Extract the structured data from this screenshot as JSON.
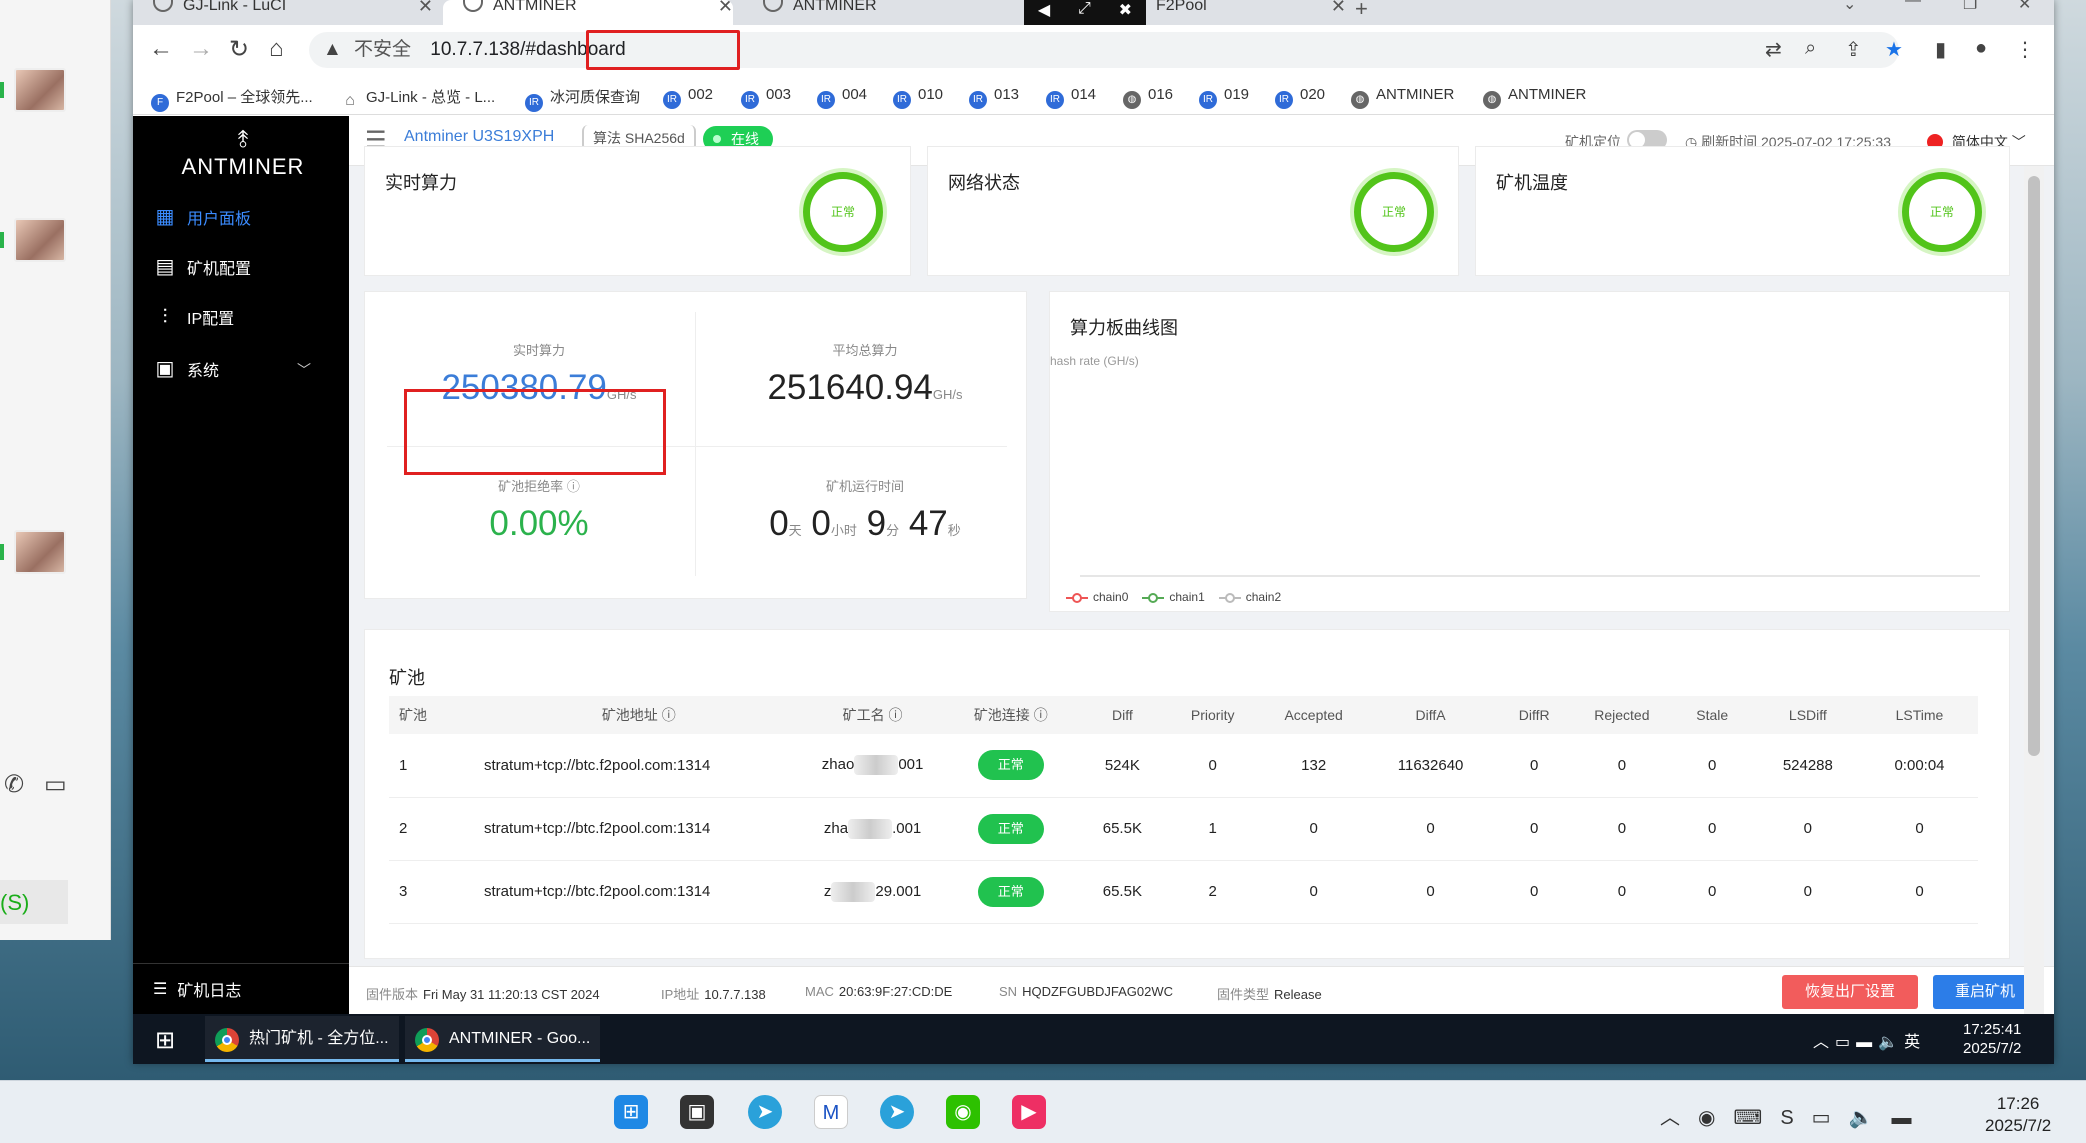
{
  "wechat": {
    "s_label": "(S)"
  },
  "tabs": [
    {
      "title": "GJ-Link - LuCI"
    },
    {
      "title": "ANTMINER"
    },
    {
      "title": "ANTMINER"
    },
    {
      "title": "F2Pool"
    }
  ],
  "address": {
    "insecure": "不安全",
    "url": "10.7.7.138/#dashboard"
  },
  "bookmarks": [
    {
      "label": "F2Pool – 全球领先..."
    },
    {
      "label": "GJ-Link - 总览 - L..."
    },
    {
      "label": "冰河质保查询"
    },
    {
      "label": "002"
    },
    {
      "label": "003"
    },
    {
      "label": "004"
    },
    {
      "label": "010"
    },
    {
      "label": "013"
    },
    {
      "label": "014"
    },
    {
      "label": "016"
    },
    {
      "label": "019"
    },
    {
      "label": "020"
    },
    {
      "label": "ANTMINER"
    },
    {
      "label": "ANTMINER"
    }
  ],
  "sidebar": {
    "logo": "ANTMINER",
    "items": [
      {
        "label": "用户面板"
      },
      {
        "label": "矿机配置"
      },
      {
        "label": "IP配置"
      },
      {
        "label": "系统"
      }
    ],
    "log": "矿机日志"
  },
  "topbar": {
    "model": "Antminer U3S19XPH",
    "algo": "算法 SHA256d",
    "status": "在线",
    "locate": "矿机定位",
    "refresh_label": "刷新时间",
    "refresh_time": "2025-07-02 17:25:33",
    "language": "简体中文"
  },
  "status_cards": [
    {
      "title": "实时算力",
      "state": "正常"
    },
    {
      "title": "网络状态",
      "state": "正常"
    },
    {
      "title": "矿机温度",
      "state": "正常"
    }
  ],
  "stats": {
    "realtime_label": "实时算力",
    "realtime_value": "250380.79",
    "avg_label": "平均总算力",
    "avg_value": "251640.94",
    "unit": "GH/s",
    "reject_label": "矿池拒绝率",
    "reject_value": "0.00%",
    "uptime_label": "矿机运行时间",
    "uptime": {
      "d": "0",
      "d_u": "天",
      "h": "0",
      "h_u": "小时",
      "m": "9",
      "m_u": "分",
      "s": "47",
      "s_u": "秒"
    }
  },
  "chart_data": {
    "type": "line",
    "title": "算力板曲线图",
    "ylabel": "hash rate (GH/s)",
    "x": [],
    "series": [
      {
        "name": "chain0",
        "values": []
      },
      {
        "name": "chain1",
        "values": []
      },
      {
        "name": "chain2",
        "values": []
      }
    ],
    "colors": [
      "#e55555",
      "#55aa55",
      "#bbbbbb"
    ],
    "legend": "bottom-left"
  },
  "pool": {
    "title": "矿池",
    "columns": [
      "矿池",
      "矿池地址",
      "矿工名",
      "矿池连接",
      "Diff",
      "Priority",
      "Accepted",
      "DiffA",
      "DiffR",
      "Rejected",
      "Stale",
      "LSDiff",
      "LSTime"
    ],
    "rows": [
      {
        "id": "1",
        "url": "stratum+tcp://btc.f2pool.com:1314",
        "w1": "zhao",
        "w2": "001",
        "state": "正常",
        "diff": "524K",
        "prio": "0",
        "acc": "132",
        "diffa": "11632640",
        "diffr": "0",
        "rej": "0",
        "stale": "0",
        "lsdiff": "524288",
        "lstime": "0:00:04"
      },
      {
        "id": "2",
        "url": "stratum+tcp://btc.f2pool.com:1314",
        "w1": "zha",
        "w2": ".001",
        "state": "正常",
        "diff": "65.5K",
        "prio": "1",
        "acc": "0",
        "diffa": "0",
        "diffr": "0",
        "rej": "0",
        "stale": "0",
        "lsdiff": "0",
        "lstime": "0"
      },
      {
        "id": "3",
        "url": "stratum+tcp://btc.f2pool.com:1314",
        "w1": "z",
        "w2": "29.001",
        "state": "正常",
        "diff": "65.5K",
        "prio": "2",
        "acc": "0",
        "diffa": "0",
        "diffr": "0",
        "rej": "0",
        "stale": "0",
        "lsdiff": "0",
        "lstime": "0"
      }
    ]
  },
  "footer": {
    "fw_label": "固件版本",
    "fw": "Fri May 31 11:20:13 CST 2024",
    "ip_label": "IP地址",
    "ip": "10.7.7.138",
    "mac_label": "MAC",
    "mac": "20:63:9F:27:CD:DE",
    "sn_label": "SN",
    "sn": "HQDZFGUBDJFAG02WC",
    "type_label": "固件类型",
    "type": "Release",
    "reset": "恢复出厂设置",
    "reboot": "重启矿机"
  },
  "vm_taskbar": {
    "apps": [
      {
        "label": "热门矿机 - 全方位..."
      },
      {
        "label": "ANTMINER - Goo..."
      }
    ],
    "ime": "英",
    "time": "17:25:41",
    "date": "2025/7/2"
  },
  "host_taskbar": {
    "time": "17:26",
    "date": "2025/7/2"
  }
}
